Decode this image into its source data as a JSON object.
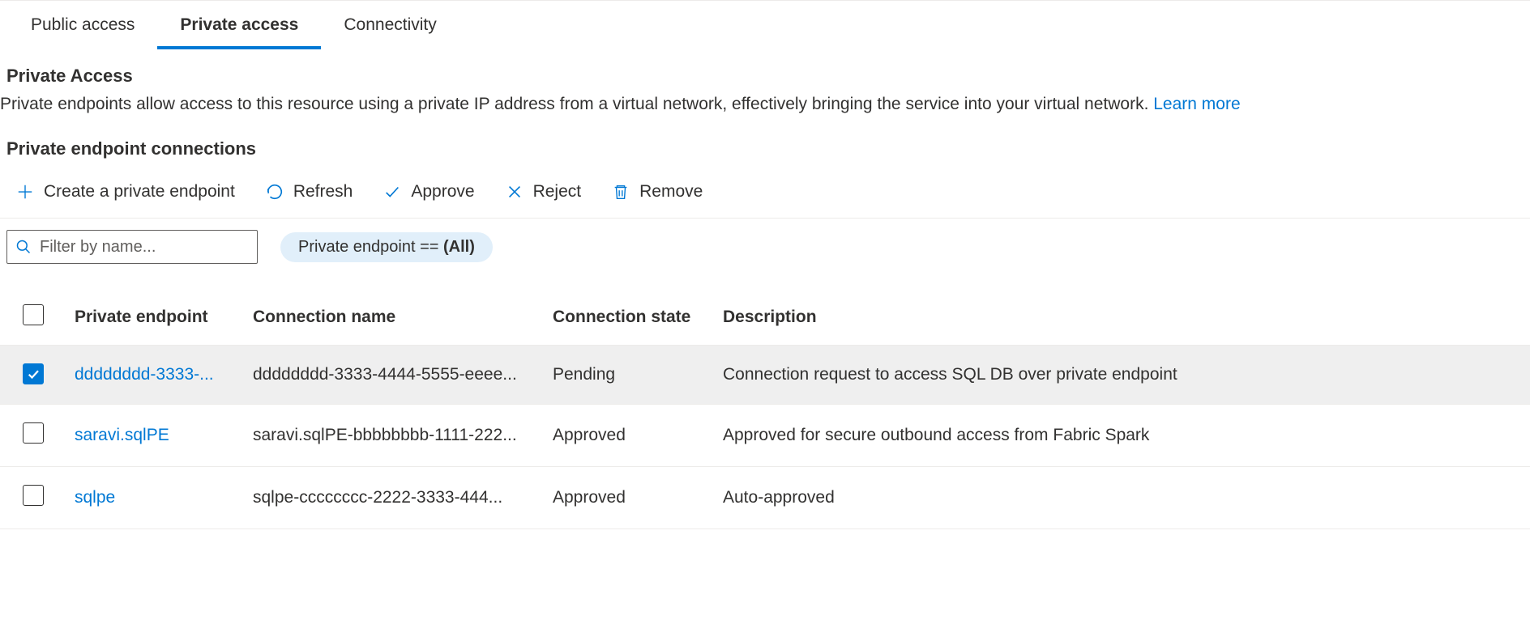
{
  "tabs": [
    {
      "label": "Public access",
      "active": false
    },
    {
      "label": "Private access",
      "active": true
    },
    {
      "label": "Connectivity",
      "active": false
    }
  ],
  "section": {
    "title": "Private Access",
    "description": "Private endpoints allow access to this resource using a private IP address from a virtual network, effectively bringing the service into your virtual network. ",
    "learn_more": "Learn more"
  },
  "subsection_title": "Private endpoint connections",
  "toolbar": {
    "create": "Create a private endpoint",
    "refresh": "Refresh",
    "approve": "Approve",
    "reject": "Reject",
    "remove": "Remove"
  },
  "filter": {
    "placeholder": "Filter by name...",
    "value": "",
    "pill_prefix": "Private endpoint == ",
    "pill_value": "(All)"
  },
  "columns": {
    "private_endpoint": "Private endpoint",
    "connection_name": "Connection name",
    "connection_state": "Connection state",
    "description": "Description"
  },
  "rows": [
    {
      "selected": true,
      "private_endpoint": "dddddddd-3333-...",
      "connection_name": "dddddddd-3333-4444-5555-eeee...",
      "connection_state": "Pending",
      "description": "Connection request to access SQL DB over private endpoint"
    },
    {
      "selected": false,
      "private_endpoint": "saravi.sqlPE",
      "connection_name": "saravi.sqlPE-bbbbbbbb-1111-222...",
      "connection_state": "Approved",
      "description": "Approved for secure outbound access from Fabric Spark"
    },
    {
      "selected": false,
      "private_endpoint": "sqlpe",
      "connection_name": "sqlpe-cccccccc-2222-3333-444...",
      "connection_state": "Approved",
      "description": "Auto-approved"
    }
  ]
}
